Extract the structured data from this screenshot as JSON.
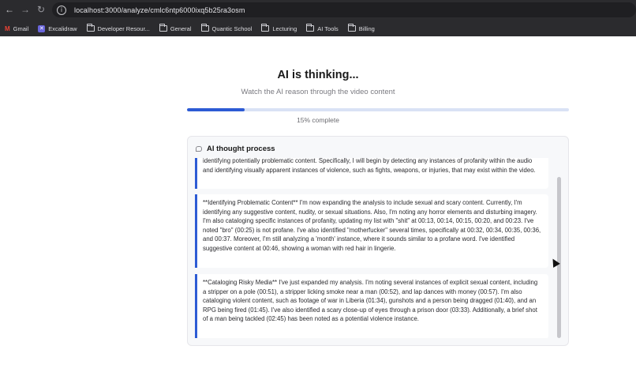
{
  "browser": {
    "url": "localhost:3000/analyze/cmlc6ntp6000ixq5b25ra3osm",
    "bookmarks": [
      {
        "label": "Gmail",
        "icon": "gmail-icon"
      },
      {
        "label": "Excalidraw",
        "icon": "excalidraw-icon"
      },
      {
        "label": "Developer Resour...",
        "icon": "folder-icon"
      },
      {
        "label": "General",
        "icon": "folder-icon"
      },
      {
        "label": "Quantic School",
        "icon": "folder-icon"
      },
      {
        "label": "Lecturing",
        "icon": "folder-icon"
      },
      {
        "label": "AI Tools",
        "icon": "folder-icon"
      },
      {
        "label": "Billing",
        "icon": "folder-icon"
      }
    ]
  },
  "page": {
    "title": "AI is thinking...",
    "subtitle": "Watch the AI reason through the video content",
    "progress_percent": 15,
    "progress_label": "15% complete"
  },
  "panel": {
    "title": "AI thought process",
    "thoughts": [
      "identifying potentially problematic content. Specifically, I will begin by detecting any instances of profanity within the audio and identifying visually apparent instances of violence, such as fights, weapons, or injuries, that may exist within the video.",
      "**Identifying Problematic Content** I'm now expanding the analysis to include sexual and scary content. Currently, I'm identifying any suggestive content, nudity, or sexual situations. Also, I'm noting any horror elements and disturbing imagery. I'm also cataloging specific instances of profanity, updating my list with \"shit\" at 00:13, 00:14, 00:15, 00:20, and 00:23. I've noted \"bro\" (00:25) is not profane. I've also identified \"motherfucker\" several times, specifically at 00:32, 00:34, 00:35, 00:36, and 00:37. Moreover, I'm still analyzing a 'month' instance, where it sounds similar to a profane word. I've identified suggestive content at 00:46, showing a woman with red hair in lingerie.",
      "**Cataloging Risky Media** I've just expanded my analysis. I'm noting several instances of explicit sexual content, including a stripper on a pole (00:51), a stripper licking smoke near a man (00:52), and lap dances with money (00:57). I'm also cataloging violent content, such as footage of war in Liberia (01:34), gunshots and a person being dragged (01:40), and an RPG being fired (01:45). I've also identified a scary close-up of eyes through a prison door (03:33). Additionally, a brief shot of a man being tackled (02:45) has been noted as a potential violence instance."
    ]
  },
  "colors": {
    "accent": "#2d5bd4",
    "progress_track": "#d9e2f5",
    "chrome_bg": "#2b2b2e"
  }
}
